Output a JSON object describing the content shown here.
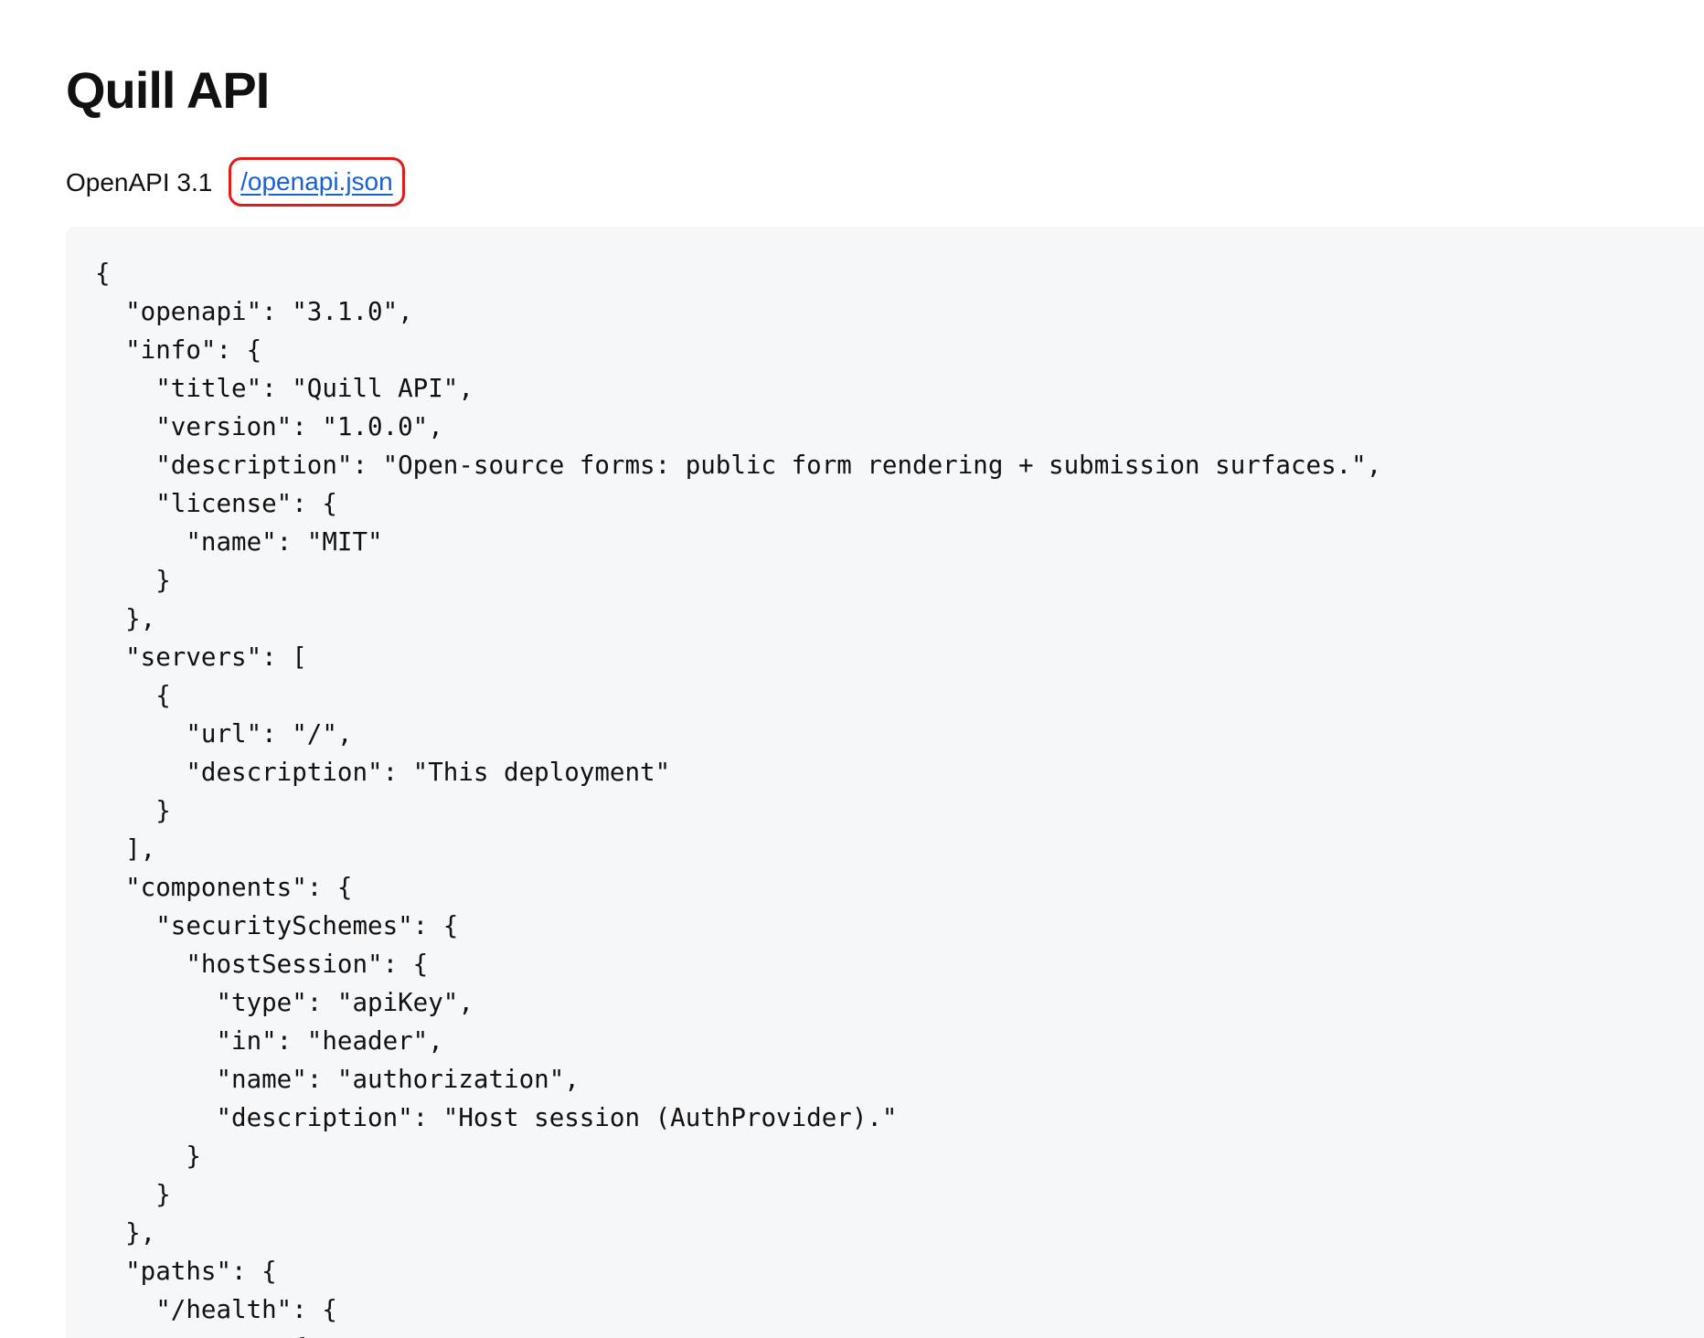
{
  "page": {
    "title": "Quill API",
    "spec_label": "OpenAPI 3.1",
    "spec_link": "/openapi.json",
    "highlight_color": "#e11a1a",
    "link_color": "#1a5fd6"
  },
  "code": {
    "lines": [
      "{",
      "  \"openapi\": \"3.1.0\",",
      "  \"info\": {",
      "    \"title\": \"Quill API\",",
      "    \"version\": \"1.0.0\",",
      "    \"description\": \"Open-source forms: public form rendering + submission surfaces.\",",
      "    \"license\": {",
      "      \"name\": \"MIT\"",
      "    }",
      "  },",
      "  \"servers\": [",
      "    {",
      "      \"url\": \"/\",",
      "      \"description\": \"This deployment\"",
      "    }",
      "  ],",
      "  \"components\": {",
      "    \"securitySchemes\": {",
      "      \"hostSession\": {",
      "        \"type\": \"apiKey\",",
      "        \"in\": \"header\",",
      "        \"name\": \"authorization\",",
      "        \"description\": \"Host session (AuthProvider).\"",
      "      }",
      "    }",
      "  },",
      "  \"paths\": {",
      "    \"/health\": {",
      "      \"get\": {"
    ]
  }
}
